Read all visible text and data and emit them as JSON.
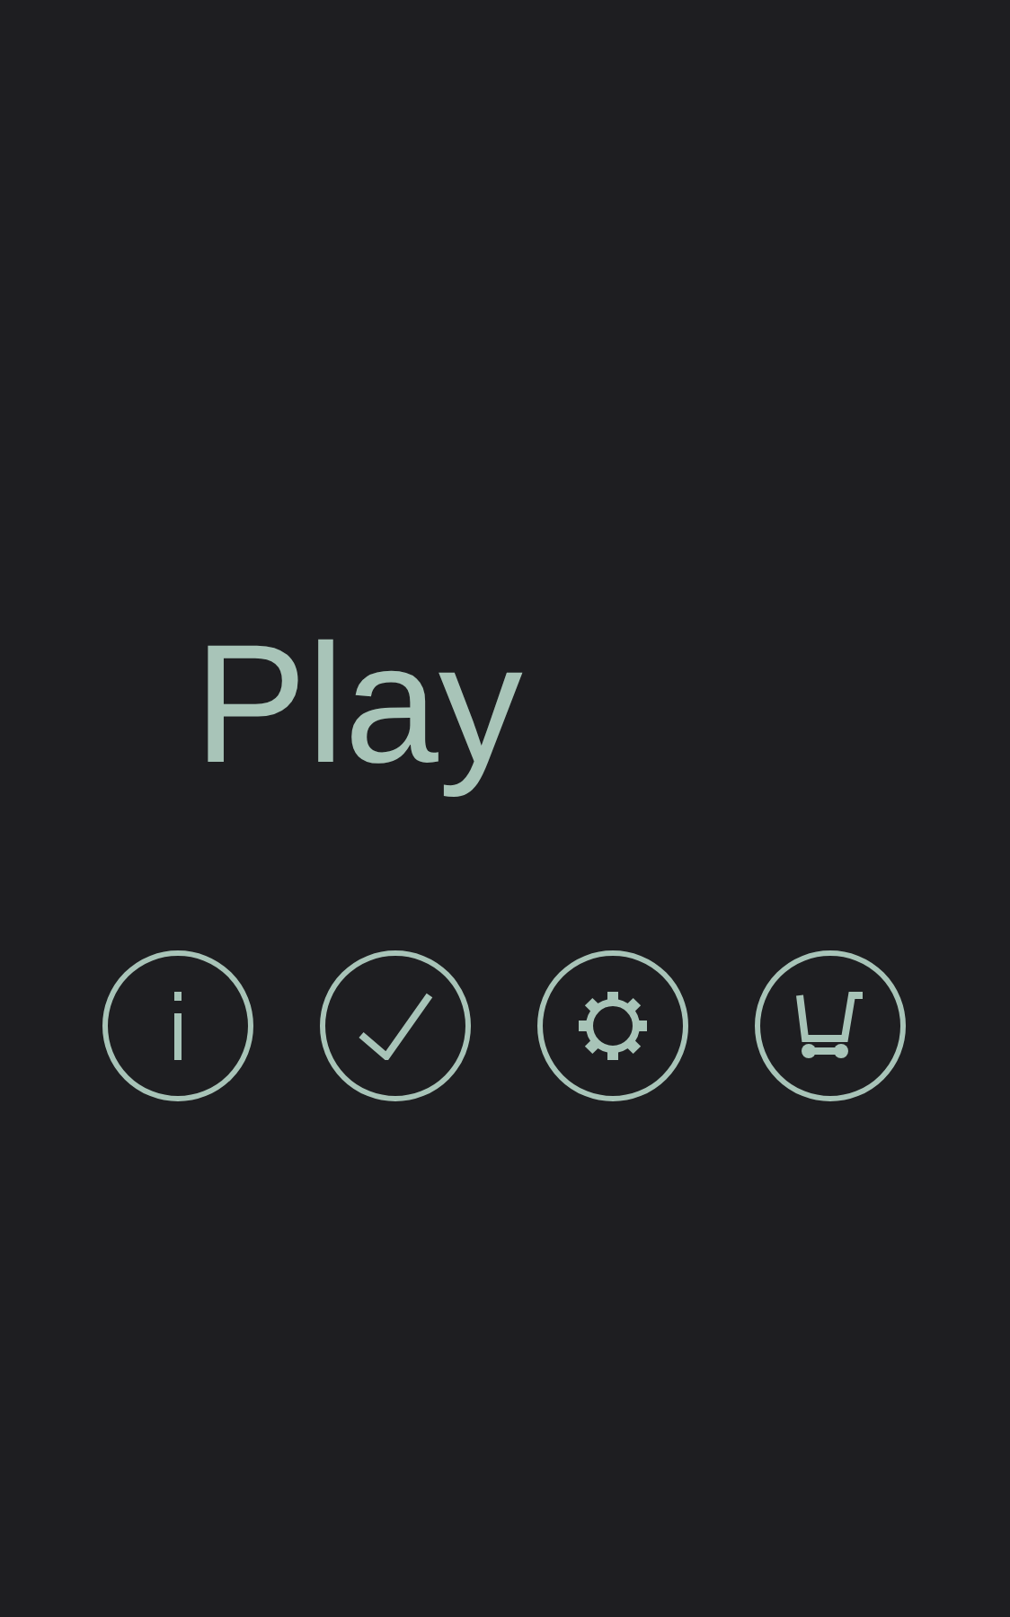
{
  "title": "Play",
  "buttons": [
    {
      "kind": "info"
    },
    {
      "kind": "check"
    },
    {
      "kind": "gear"
    },
    {
      "kind": "cart"
    }
  ]
}
